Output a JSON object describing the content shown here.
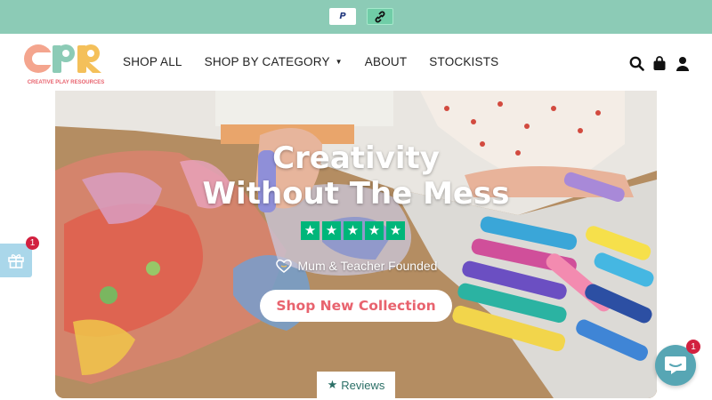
{
  "topbar": {
    "payment_badges": [
      {
        "name": "paypal",
        "label": "P"
      },
      {
        "name": "link",
        "icon": "link-icon"
      }
    ]
  },
  "header": {
    "logo": {
      "letters": "CPR",
      "tagline": "CREATIVE PLAY RESOURCES"
    },
    "nav": [
      {
        "label": "SHOP ALL"
      },
      {
        "label": "SHOP BY CATEGORY",
        "has_dropdown": true
      },
      {
        "label": "ABOUT"
      },
      {
        "label": "STOCKISTS"
      }
    ],
    "icons": [
      "search-icon",
      "bag-icon",
      "account-icon"
    ]
  },
  "hero": {
    "title_line1": "Creativity",
    "title_line2": "Without The Mess",
    "rating_stars": 5,
    "founded_text": "Mum & Teacher Founded",
    "cta_label": "Shop New Collection",
    "reviews_label": "Reviews"
  },
  "widgets": {
    "gift_badge_count": "1",
    "chat_badge_count": "1"
  },
  "colors": {
    "topbar": "#8ccbb6",
    "accent_pink": "#e8636e",
    "trustpilot_green": "#00b67a",
    "badge_red": "#d2203f",
    "chat_teal": "#57a6b4"
  }
}
